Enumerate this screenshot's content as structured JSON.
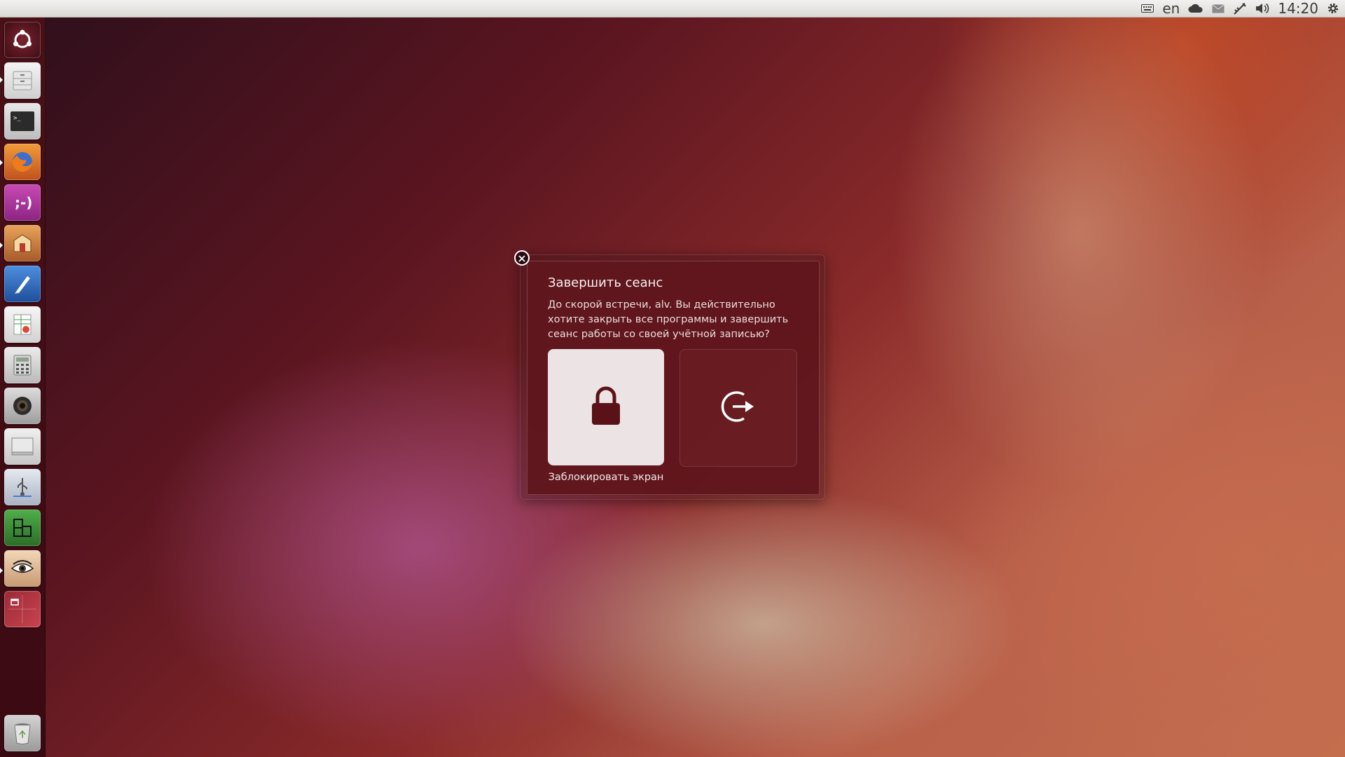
{
  "top_panel": {
    "keyboard_layout": "en",
    "clock": "14:20",
    "icons": [
      "keyboard-icon",
      "cloud-icon",
      "mail-icon",
      "network-icon",
      "volume-icon",
      "gear-icon"
    ]
  },
  "launcher": {
    "items": [
      {
        "name": "dash-home-icon"
      },
      {
        "name": "files-icon"
      },
      {
        "name": "terminal-icon"
      },
      {
        "name": "firefox-icon"
      },
      {
        "name": "empathy-chat-icon"
      },
      {
        "name": "software-center-icon"
      },
      {
        "name": "text-editor-icon"
      },
      {
        "name": "spreadsheet-icon"
      },
      {
        "name": "calculator-icon"
      },
      {
        "name": "camera-icon"
      },
      {
        "name": "screen-icon"
      },
      {
        "name": "usb-drive-icon"
      },
      {
        "name": "system-monitor-icon"
      },
      {
        "name": "eye-of-gnome-icon"
      },
      {
        "name": "workspace-switcher-icon"
      },
      {
        "name": "trash-icon"
      }
    ]
  },
  "dialog": {
    "title": "Завершить сеанс",
    "message": "До скорой встречи, alv. Вы действительно хотите закрыть все программы и завершить сеанс работы со своей учётной записью?",
    "lock_label": "Заблокировать экран",
    "colors": {
      "dialog_bg": "#5f161c",
      "lock_button_bg": "#ebe3e4",
      "lock_icon": "#5a1218"
    }
  }
}
